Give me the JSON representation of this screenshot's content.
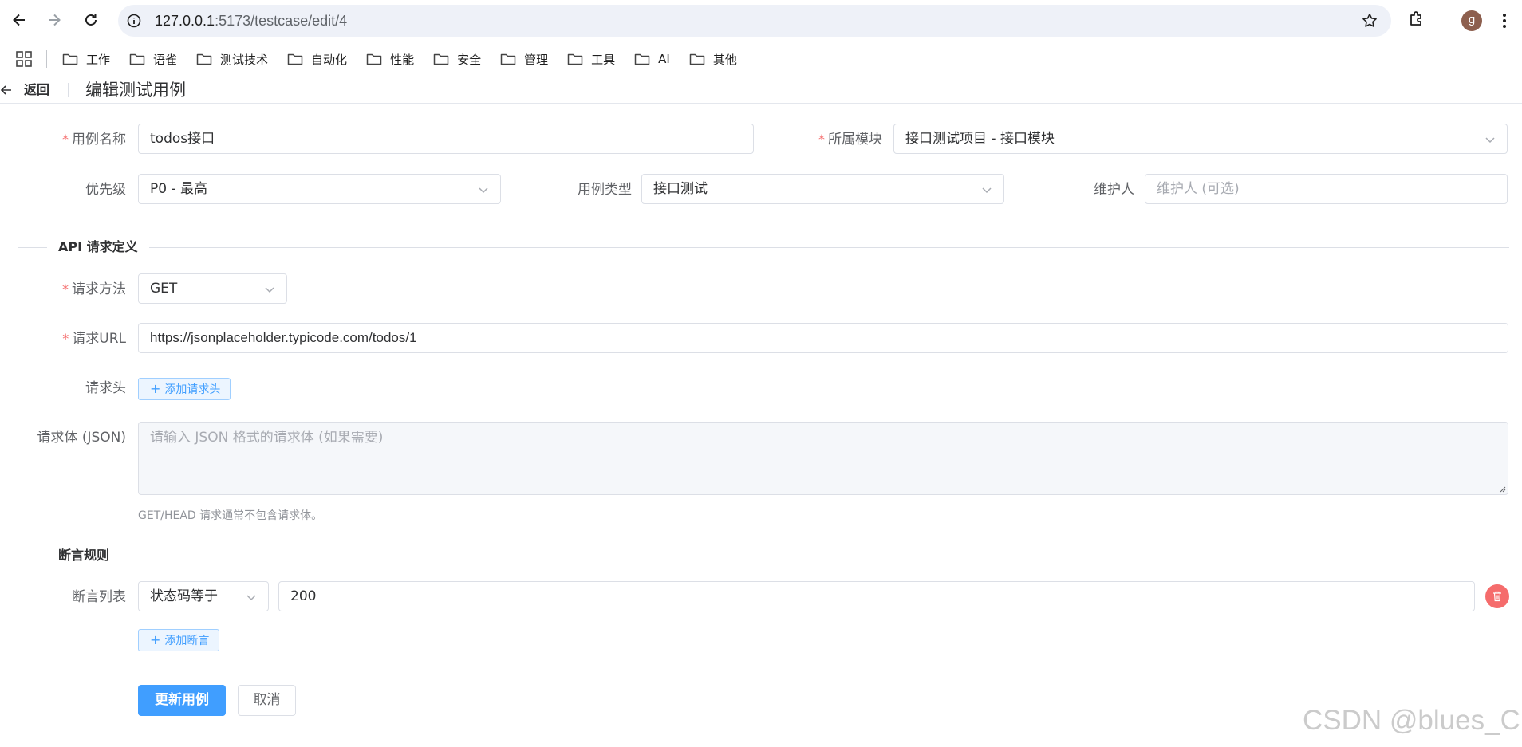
{
  "browser": {
    "url_host": "127.0.0.1",
    "url_rest": ":5173/testcase/edit/4",
    "profile_initial": "g",
    "bookmarks": [
      "工作",
      "语雀",
      "测试技术",
      "自动化",
      "性能",
      "安全",
      "管理",
      "工具",
      "AI",
      "其他"
    ]
  },
  "header": {
    "back_label": "返回",
    "title": "编辑测试用例"
  },
  "form": {
    "case_name": {
      "label": "用例名称",
      "value": "todos接口"
    },
    "module": {
      "label": "所属模块",
      "value": "接口测试项目 - 接口模块"
    },
    "priority": {
      "label": "优先级",
      "value": "P0 - 最高"
    },
    "case_type": {
      "label": "用例类型",
      "value": "接口测试"
    },
    "maintainer": {
      "label": "维护人",
      "placeholder": "维护人 (可选)"
    }
  },
  "api": {
    "section_title": "API 请求定义",
    "method": {
      "label": "请求方法",
      "value": "GET"
    },
    "url": {
      "label": "请求URL",
      "value": "https://jsonplaceholder.typicode.com/todos/1"
    },
    "headers": {
      "label": "请求头",
      "add_label": "添加请求头"
    },
    "body": {
      "label": "请求体 (JSON)",
      "placeholder": "请输入 JSON 格式的请求体 (如果需要)",
      "hint": "GET/HEAD 请求通常不包含请求体。"
    }
  },
  "assertions": {
    "section_title": "断言规则",
    "list_label": "断言列表",
    "items": [
      {
        "type": "状态码等于",
        "value": "200"
      }
    ],
    "add_label": "添加断言"
  },
  "actions": {
    "submit": "更新用例",
    "cancel": "取消"
  },
  "watermark": "CSDN @blues_C",
  "colors": {
    "primary": "#409eff",
    "danger": "#f56c6c",
    "required_mark": "#f56c6c",
    "border": "#dcdfe6"
  }
}
